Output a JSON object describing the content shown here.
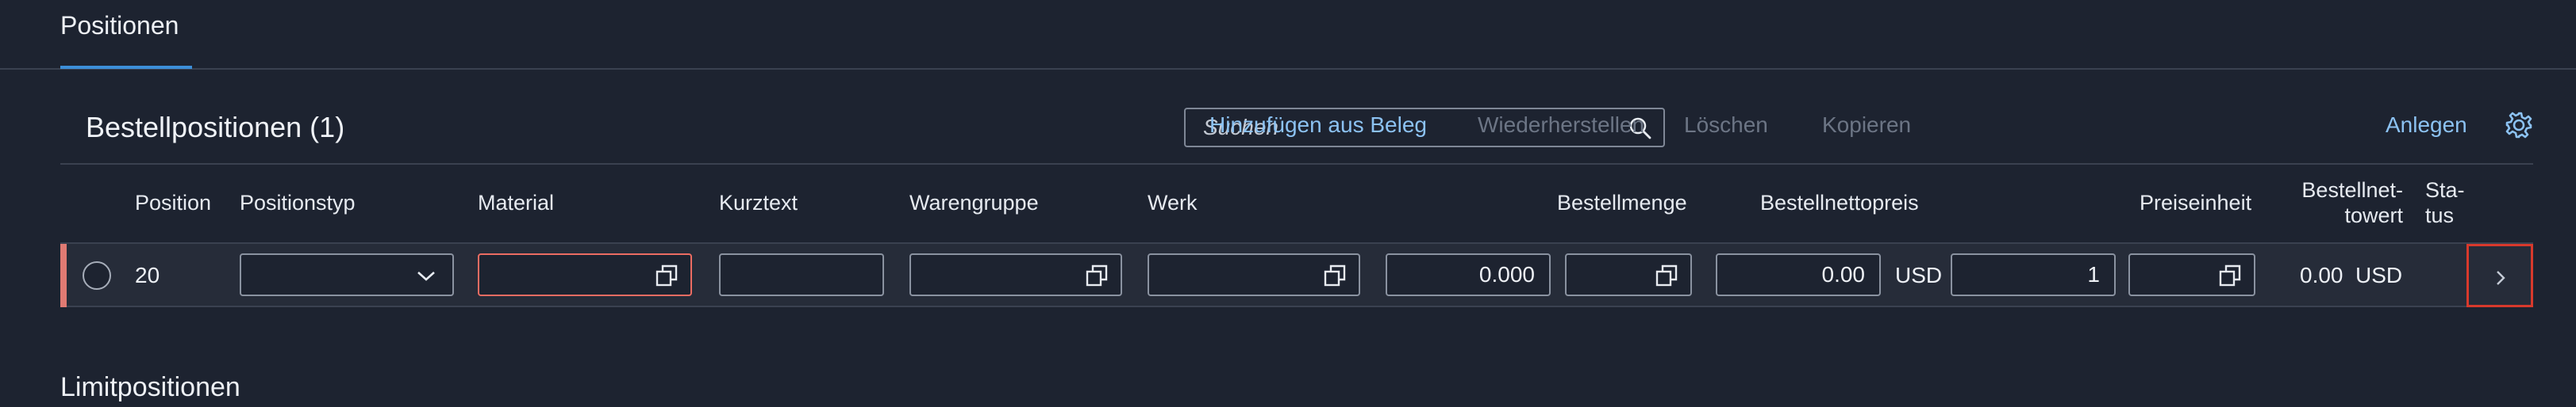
{
  "section_tabs": {
    "active": "Positionen"
  },
  "table": {
    "title": "Bestellpositionen (1)",
    "search": {
      "placeholder": "Suchen",
      "value": ""
    },
    "toolbar": {
      "add_from_doc": "Hinzufügen aus Beleg",
      "restore": "Wiederherstellen",
      "delete": "Löschen",
      "copy": "Kopieren",
      "create": "Anlegen"
    },
    "columns": {
      "position": "Position",
      "item_type": "Positionstyp",
      "material": "Material",
      "short_text": "Kurztext",
      "material_group": "Warengruppe",
      "plant": "Werk",
      "quantity": "Bestellmenge",
      "net_price": "Bestellnettopreis",
      "price_unit": "Preiseinheit",
      "net_value_line1": "Bestellnet-",
      "net_value_line2": "towert",
      "status_line1": "Sta-",
      "status_line2": "tus"
    },
    "rows": [
      {
        "position": "20",
        "item_type": "",
        "material": "",
        "short_text": "",
        "material_group": "",
        "plant": "",
        "quantity": "0.000",
        "net_price": "0.00",
        "net_price_currency": "USD",
        "price_unit_qty": "1",
        "price_unit": "",
        "net_value": "0.00",
        "net_value_currency": "USD"
      }
    ]
  },
  "next_section": {
    "title": "Limitpositionen"
  },
  "colors": {
    "background": "#1d2330",
    "link": "#8cc2f2",
    "disabled": "#6c7585",
    "error": "#ec6c62",
    "row_highlight": "#e07a73",
    "focus_outline": "#d8392c"
  },
  "icons": [
    "search-icon",
    "settings-icon",
    "chevron-down-icon",
    "value-help-icon",
    "chevron-right-icon"
  ]
}
